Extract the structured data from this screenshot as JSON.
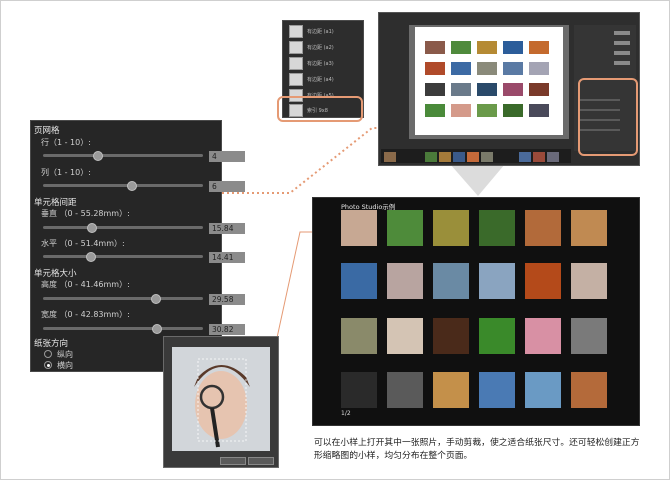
{
  "panel": {
    "page_grid": "页网格",
    "rows_label": "行（1 - 10）:",
    "rows_value": "4",
    "rows_level": 0.33,
    "cols_label": "列（1 - 10）:",
    "cols_value": "6",
    "cols_level": 0.55,
    "cell_spacing": "单元格间距",
    "vertical_label": "垂直 （0 - 55.28mm）:",
    "vertical_value": "15.84",
    "vertical_level": 0.29,
    "horizontal_label": "水平 （0 - 51.4mm）:",
    "horizontal_value": "14.41",
    "horizontal_level": 0.28,
    "cell_size": "单元格大小",
    "height_label": "高度 （0 - 41.46mm）:",
    "height_value": "29.58",
    "height_level": 0.71,
    "width_label": "宽度 （0 - 42.83mm）:",
    "width_value": "30.82",
    "width_level": 0.72,
    "orientation": "纸张方向",
    "portrait": "纵向",
    "landscape": "横向",
    "selected_orientation": "landscape"
  },
  "menu": {
    "items": [
      "有边距 (a1)",
      "有边距 (a2)",
      "有边距 (a3)",
      "有边距 (a4)",
      "有边距 (a5)",
      "索引 9x8"
    ]
  },
  "preview": {
    "title": "Photo Studio示例",
    "page": "1/2"
  },
  "caption": "可以在小样上打开其中一张照片，手动剪裁，使之适合纸张尺寸。还可轻松创建正方形缩略图的小样，均匀分布在整个页面。",
  "colors": {
    "accent": "#e59a74",
    "panel_bg": "#262626",
    "preview_bg": "#101010"
  }
}
